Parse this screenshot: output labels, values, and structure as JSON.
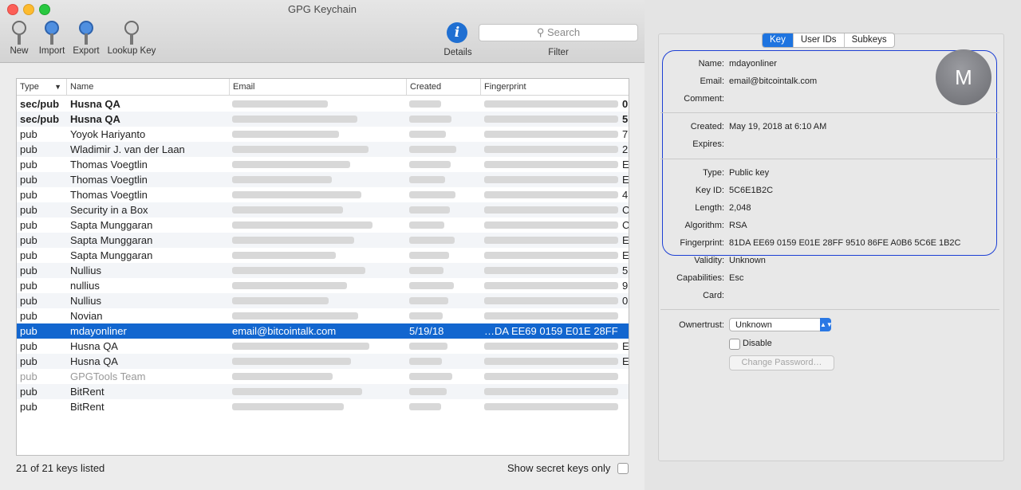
{
  "window": {
    "title": "GPG Keychain"
  },
  "toolbar": {
    "new_label": "New",
    "import_label": "Import",
    "export_label": "Export",
    "lookup_label": "Lookup Key",
    "details_label": "Details",
    "filter_label": "Filter",
    "search_placeholder": "Search"
  },
  "table": {
    "headers": {
      "type": "Type",
      "name": "Name",
      "email": "Email",
      "created": "Created",
      "fingerprint": "Fingerprint"
    },
    "rows": [
      {
        "type": "sec/pub",
        "name": "Husna QA",
        "fp_tail": "0",
        "style": "bold"
      },
      {
        "type": "sec/pub",
        "name": "Husna QA",
        "fp_tail": "5",
        "style": "bold"
      },
      {
        "type": "pub",
        "name": "Yoyok Hariyanto",
        "fp_tail": "7",
        "style": ""
      },
      {
        "type": "pub",
        "name": "Wladimir J. van der Laan",
        "fp_tail": "2",
        "style": ""
      },
      {
        "type": "pub",
        "name": "Thomas Voegtlin",
        "fp_tail": "E",
        "style": ""
      },
      {
        "type": "pub",
        "name": "Thomas Voegtlin",
        "fp_tail": "E",
        "style": ""
      },
      {
        "type": "pub",
        "name": "Thomas Voegtlin",
        "fp_tail": "4",
        "style": ""
      },
      {
        "type": "pub",
        "name": "Security in a Box",
        "fp_tail": "C",
        "style": ""
      },
      {
        "type": "pub",
        "name": "Sapta Munggaran",
        "fp_tail": "C",
        "style": ""
      },
      {
        "type": "pub",
        "name": "Sapta Munggaran",
        "fp_tail": "E",
        "style": ""
      },
      {
        "type": "pub",
        "name": "Sapta Munggaran",
        "fp_tail": "E",
        "style": ""
      },
      {
        "type": "pub",
        "name": "Nullius",
        "fp_tail": "5",
        "style": ""
      },
      {
        "type": "pub",
        "name": "nullius",
        "fp_tail": "9",
        "style": ""
      },
      {
        "type": "pub",
        "name": "Nullius",
        "fp_tail": "0",
        "style": ""
      },
      {
        "type": "pub",
        "name": "Novian",
        "fp_tail": "",
        "style": ""
      },
      {
        "type": "pub",
        "name": "mdayonliner",
        "email": "email@bitcointalk.com",
        "created": "5/19/18",
        "fingerprint": "…DA EE69 0159 E01E 28FF",
        "style": "sel"
      },
      {
        "type": "pub",
        "name": "Husna QA",
        "fp_tail": "E",
        "style": ""
      },
      {
        "type": "pub",
        "name": "Husna QA",
        "fp_tail": "E",
        "style": ""
      },
      {
        "type": "pub",
        "name": "GPGTools Team",
        "fp_tail": "",
        "style": "dim"
      },
      {
        "type": "pub",
        "name": "BitRent",
        "fp_tail": "",
        "style": ""
      },
      {
        "type": "pub",
        "name": "BitRent",
        "fp_tail": "",
        "style": ""
      }
    ]
  },
  "footer": {
    "count_text": "21 of 21 keys listed",
    "show_secret_label": "Show secret keys only"
  },
  "inspector": {
    "tabs": [
      "Key",
      "User IDs",
      "Subkeys"
    ],
    "avatar_letter": "M",
    "labels": {
      "name": "Name:",
      "email": "Email:",
      "comment": "Comment:",
      "created": "Created:",
      "expires": "Expires:",
      "type": "Type:",
      "keyid": "Key ID:",
      "length": "Length:",
      "algorithm": "Algorithm:",
      "fingerprint": "Fingerprint:",
      "validity": "Validity:",
      "capabilities": "Capabilities:",
      "card": "Card:",
      "ownertrust": "Ownertrust:"
    },
    "values": {
      "name": "mdayonliner",
      "email": "email@bitcointalk.com",
      "comment": "",
      "created": "May 19, 2018 at 6:10 AM",
      "expires": "",
      "type": "Public key",
      "keyid": "5C6E1B2C",
      "length": "2,048",
      "algorithm": "RSA",
      "fingerprint": "81DA EE69 0159 E01E 28FF  9510 86FE A0B6 5C6E 1B2C",
      "validity": "Unknown",
      "capabilities": "Esc",
      "card": ""
    },
    "ownertrust_value": "Unknown",
    "disable_label": "Disable",
    "change_password_label": "Change Password…"
  },
  "colors": {
    "selection": "#1266cf",
    "highlight_outline": "#1c3fd4",
    "accent": "#1e74e0"
  }
}
